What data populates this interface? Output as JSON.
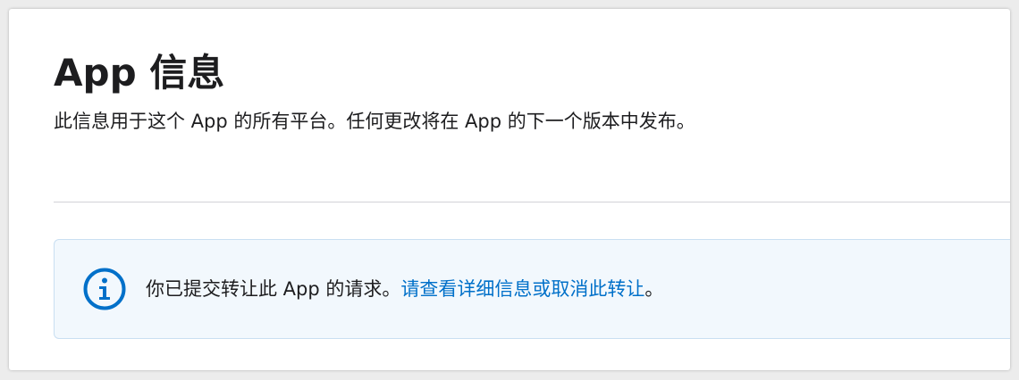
{
  "section": {
    "title": "App 信息",
    "description": "此信息用于这个 App 的所有平台。任何更改将在 App 的下一个版本中发布。"
  },
  "notice": {
    "icon": "info-circle-icon",
    "message": "你已提交转让此 App 的请求。",
    "link_label": "请查看详细信息或取消此转让",
    "end_punctuation": "。",
    "accent_color": "#0070c9"
  }
}
